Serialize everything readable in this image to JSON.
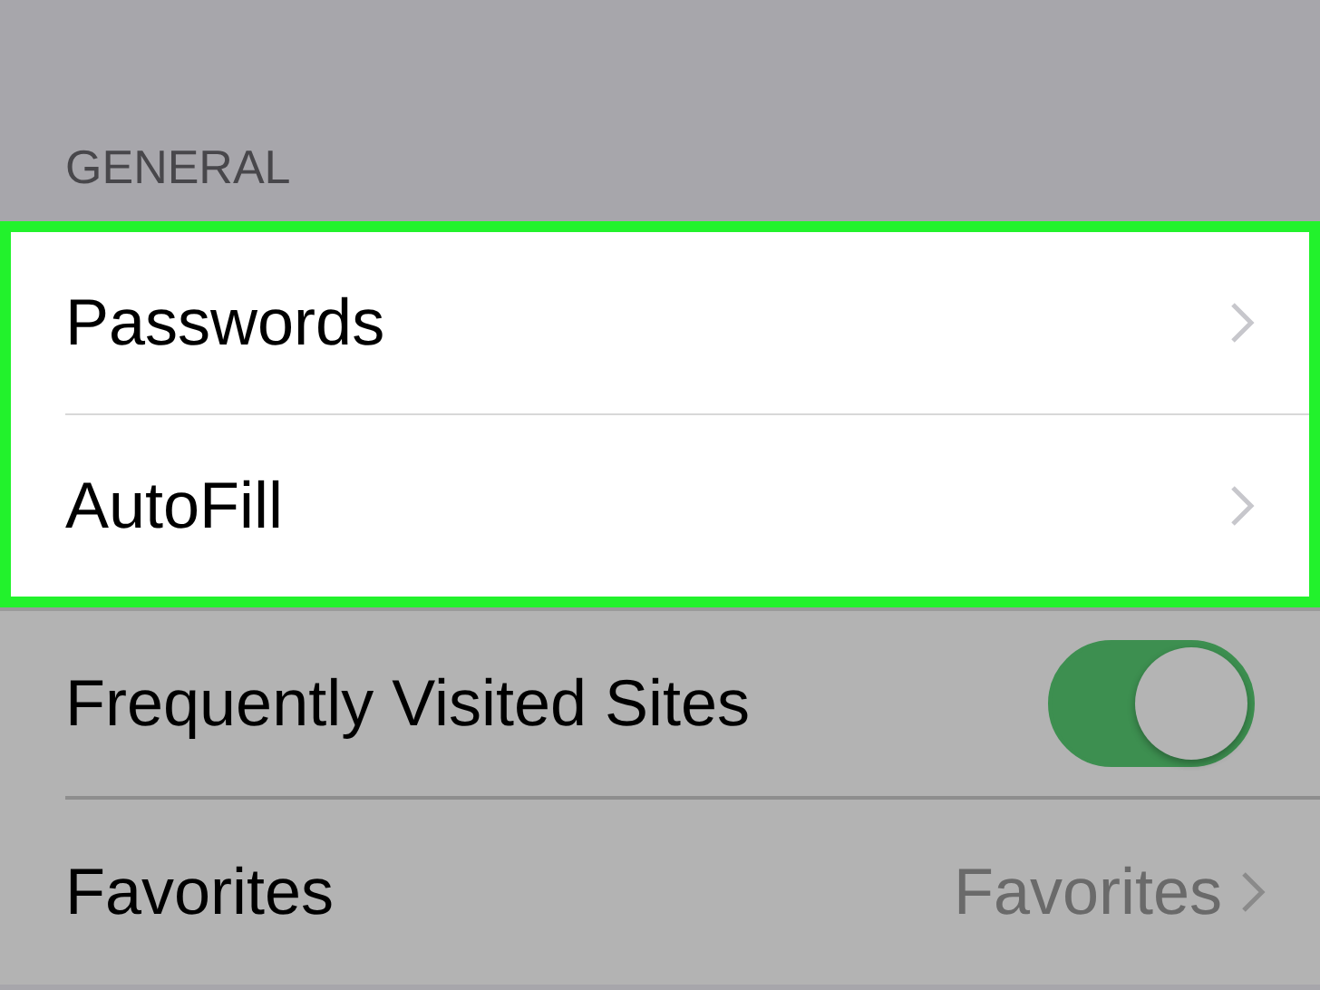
{
  "section_header": "GENERAL",
  "rows": [
    {
      "kind": "link",
      "label": "Passwords",
      "highlighted": true
    },
    {
      "kind": "link",
      "label": "AutoFill",
      "highlighted": true
    },
    {
      "kind": "toggle",
      "label": "Frequently Visited Sites",
      "highlighted": false,
      "on": true
    },
    {
      "kind": "link",
      "label": "Favorites",
      "value": "Favorites",
      "highlighted": false
    }
  ]
}
